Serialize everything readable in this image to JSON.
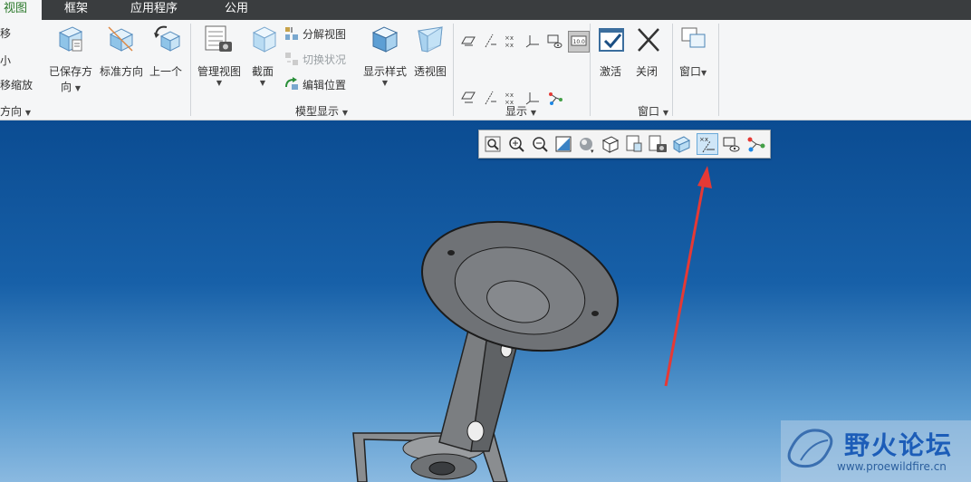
{
  "tabs": [
    {
      "label": "视图",
      "active": true
    },
    {
      "label": "框架",
      "active": false
    },
    {
      "label": "应用程序",
      "active": false
    },
    {
      "label": "公用",
      "active": false
    }
  ],
  "ribbon": {
    "orientation_group": {
      "partial_items": [
        "移",
        "小",
        "移缩放"
      ],
      "saved_orientation": "已保存方\n向",
      "saved_orientation_line1": "已保存方",
      "saved_orientation_line2": "向",
      "standard_orientation": "标准方向",
      "previous": "上一个",
      "group_label": "方向"
    },
    "model_display_group": {
      "manage_views": "管理视图",
      "section": "截面",
      "exploded_view": "分解视图",
      "toggle_status": "切换状况",
      "edit_position": "编辑位置",
      "display_style": "显示样式",
      "perspective": "透视图",
      "group_label": "模型显示"
    },
    "show_group": {
      "group_label": "显示"
    },
    "window_group": {
      "activate": "激活",
      "close": "关闭",
      "window": "窗口",
      "group_label": "窗口"
    }
  },
  "floating_toolbar": {
    "buttons": [
      "refit-icon",
      "zoom-in-icon",
      "zoom-out-icon",
      "repaint-icon",
      "saved-orientations-icon",
      "display-style-icon",
      "named-views-icon",
      "view-manager-icon",
      "spin-center-icon",
      "datum-display-filters-icon",
      "annotation-display-icon",
      "network-icon"
    ],
    "selected": "datum-display-filters-icon"
  },
  "watermark": {
    "title": "野火论坛",
    "url": "www.proewildfire.cn"
  },
  "colors": {
    "tabbar_bg": "#3a3d3f",
    "ribbon_bg": "#f5f6f7",
    "active_tab_text": "#2d7a2d",
    "viewport_top": "#0b4c92",
    "viewport_bottom": "#8ab9e0",
    "annotation_arrow": "#e53935"
  }
}
